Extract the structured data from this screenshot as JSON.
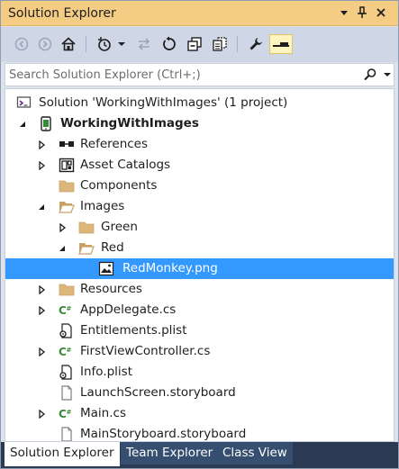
{
  "window": {
    "title": "Solution Explorer"
  },
  "titlebar_buttons": [
    {
      "name": "dropdown-icon",
      "glyph": "▾"
    },
    {
      "name": "pin-icon",
      "glyph": "📌"
    },
    {
      "name": "close-icon",
      "glyph": "✕"
    }
  ],
  "search": {
    "placeholder": "Search Solution Explorer (Ctrl+;)"
  },
  "tree": [
    {
      "label": "Solution 'WorkingWithImages' (1 project)",
      "icon": "solution-icon",
      "level": 0,
      "expander": "none"
    },
    {
      "label": "WorkingWithImages",
      "icon": "project-icon",
      "level": 1,
      "expander": "expanded",
      "bold": true
    },
    {
      "label": "References",
      "icon": "references-icon",
      "level": 2,
      "expander": "collapsed"
    },
    {
      "label": "Asset Catalogs",
      "icon": "asset-catalog-icon",
      "level": 2,
      "expander": "collapsed"
    },
    {
      "label": "Components",
      "icon": "folder-icon",
      "level": 2,
      "expander": "none"
    },
    {
      "label": "Images",
      "icon": "folder-open-icon",
      "level": 2,
      "expander": "expanded"
    },
    {
      "label": "Green",
      "icon": "folder-icon",
      "level": 3,
      "expander": "collapsed"
    },
    {
      "label": "Red",
      "icon": "folder-open-icon",
      "level": 3,
      "expander": "expanded"
    },
    {
      "label": "RedMonkey.png",
      "icon": "image-file-icon",
      "level": 4,
      "expander": "none",
      "selected": true
    },
    {
      "label": "Resources",
      "icon": "folder-icon",
      "level": 2,
      "expander": "collapsed"
    },
    {
      "label": "AppDelegate.cs",
      "icon": "csharp-file-icon",
      "level": 2,
      "expander": "collapsed"
    },
    {
      "label": "Entitlements.plist",
      "icon": "plist-file-icon",
      "level": 2,
      "expander": "none"
    },
    {
      "label": "FirstViewController.cs",
      "icon": "csharp-file-icon",
      "level": 2,
      "expander": "collapsed"
    },
    {
      "label": "Info.plist",
      "icon": "plist-file-icon",
      "level": 2,
      "expander": "none"
    },
    {
      "label": "LaunchScreen.storyboard",
      "icon": "document-file-icon",
      "level": 2,
      "expander": "none"
    },
    {
      "label": "Main.cs",
      "icon": "csharp-file-icon",
      "level": 2,
      "expander": "collapsed"
    },
    {
      "label": "MainStoryboard.storyboard",
      "icon": "document-file-icon",
      "level": 2,
      "expander": "none"
    }
  ],
  "tabs": [
    {
      "label": "Solution Explorer",
      "active": true
    },
    {
      "label": "Team Explorer",
      "active": false
    },
    {
      "label": "Class View",
      "active": false
    }
  ],
  "colors": {
    "titlebar": "#f5cc84",
    "selection": "#3399ff",
    "toolbar": "#cfd6e5",
    "tab_strip": "#2b3a52",
    "csharp_icon": "#388a34",
    "folder": "#dcb67a"
  }
}
